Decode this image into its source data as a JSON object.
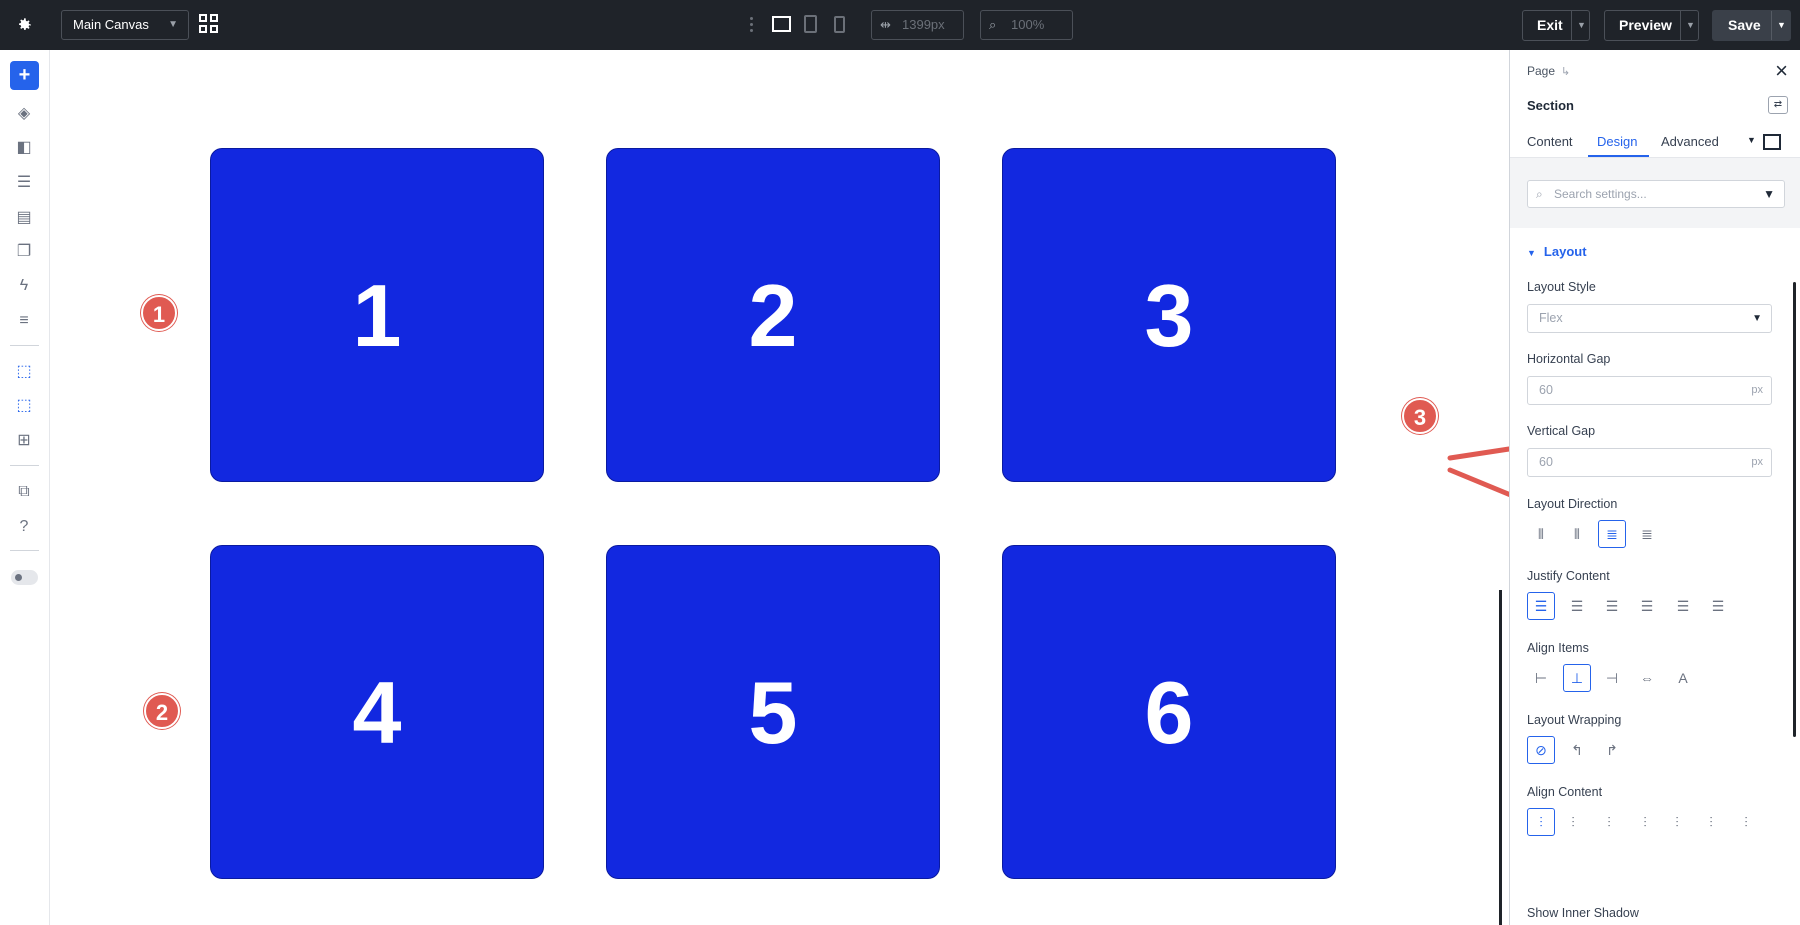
{
  "topbar": {
    "canvas_name": "Main Canvas",
    "width_value": "1399px",
    "zoom_value": "100%",
    "exit_label": "Exit",
    "preview_label": "Preview",
    "save_label": "Save"
  },
  "canvas": {
    "tiles": [
      "1",
      "2",
      "3",
      "4",
      "5",
      "6"
    ],
    "tile_color": "#1228e0",
    "badges": [
      "1",
      "2",
      "3"
    ],
    "badge_color": "#e05a52"
  },
  "panel": {
    "breadcrumb": "Page",
    "breadcrumb_sub": "↳",
    "element_title": "Section",
    "tabs": [
      "Content",
      "Design",
      "Advanced"
    ],
    "active_tab": "Design",
    "search_placeholder": "Search settings...",
    "group_title": "Layout",
    "layout_style_label": "Layout Style",
    "layout_style_value": "Flex",
    "horizontal_gap_label": "Horizontal Gap",
    "horizontal_gap_value": "60",
    "vertical_gap_label": "Vertical Gap",
    "vertical_gap_value": "60",
    "unit": "px",
    "layout_direction_label": "Layout Direction",
    "justify_content_label": "Justify Content",
    "align_items_label": "Align Items",
    "layout_wrapping_label": "Layout Wrapping",
    "align_content_label": "Align Content",
    "inner_shadow_label": "Show Inner Shadow",
    "accent_color": "#2563eb"
  }
}
